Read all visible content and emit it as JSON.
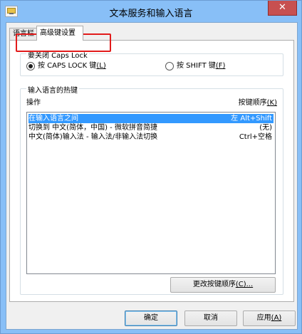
{
  "window": {
    "title": "文本服务和输入语言",
    "close_glyph": "✕",
    "accent_color": "#88bff7",
    "close_color": "#c75050"
  },
  "tabs": [
    {
      "label": "语言栏",
      "active": false
    },
    {
      "label": "高级键设置",
      "active": true
    }
  ],
  "caps_lock": {
    "group_title": "要关闭 Caps Lock",
    "options": [
      {
        "label": "按 CAPS LOCK 键",
        "accel": "(L)",
        "checked": true
      },
      {
        "label": "按 SHIFT 键",
        "accel": "(F)",
        "checked": false
      }
    ]
  },
  "hotkeys": {
    "group_title": "输入语言的热键",
    "col_action": "操作",
    "col_key_label": "按键顺序",
    "col_key_accel": "(K)",
    "rows": [
      {
        "action": "在输入语言之间",
        "key": "左 Alt+Shift",
        "selected": true
      },
      {
        "action": "切换到 中文(简体，中国) - 微软拼音简捷",
        "key": "(无)",
        "selected": false
      },
      {
        "action": "中文(简体)输入法 - 输入法/非输入法切换",
        "key": "Ctrl+空格",
        "selected": false
      }
    ],
    "change_button_label": "更改按键顺序",
    "change_button_accel": "(C)...",
    "selected_color": "#3399ff"
  },
  "footer": {
    "ok_label": "确定",
    "cancel_label": "取消",
    "apply_label": "应用",
    "apply_accel": "(A)"
  }
}
